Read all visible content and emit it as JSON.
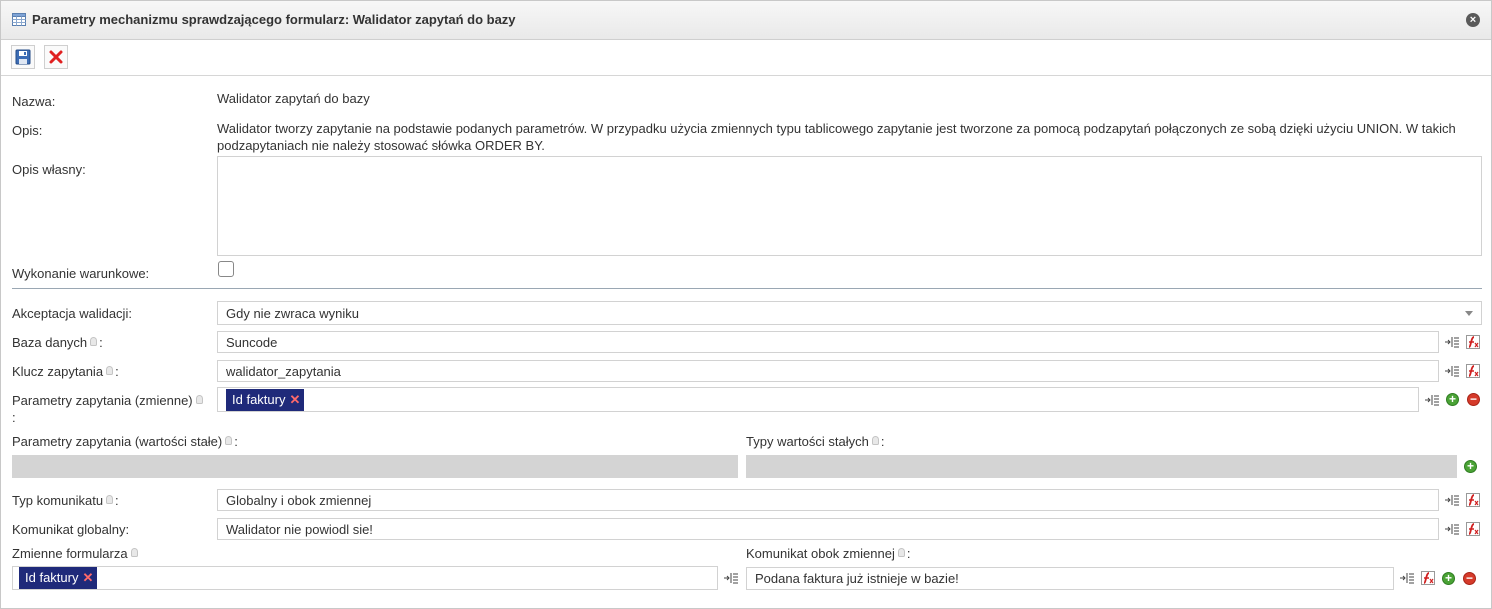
{
  "window": {
    "title": "Parametry mechanizmu sprawdzającego formularz: Walidator zapytań do bazy"
  },
  "form": {
    "nazwa_label": "Nazwa:",
    "nazwa_value": "Walidator zapytań do bazy",
    "opis_label": "Opis:",
    "opis_value_line1": "Walidator tworzy zapytanie na podstawie podanych parametrów. W przypadku użycia zmiennych typu tablicowego zapytanie jest tworzone za pomocą podzapytań połączonych ze sobą dzięki użyciu UNION. W takich",
    "opis_value_line2": "podzapytaniach nie należy stosować słówka ORDER BY.",
    "opis_wlasny_label": "Opis własny:",
    "opis_wlasny_value": "",
    "wykonanie_label": "Wykonanie warunkowe:",
    "wykonanie_checked": false,
    "akceptacja_label": "Akceptacja walidacji:",
    "akceptacja_value": "Gdy nie zwraca wyniku",
    "baza_label": "Baza danych",
    "baza_value": "Suncode",
    "klucz_label": "Klucz zapytania",
    "klucz_value": "walidator_zapytania",
    "param_zmienne_label": "Parametry zapytania (zmienne)",
    "param_zmienne_tags": [
      "Id faktury"
    ],
    "param_stale_label": "Parametry zapytania (wartości stałe)",
    "typy_stalych_label": "Typy wartości stałych",
    "typ_komunikatu_label": "Typ komunikatu",
    "typ_komunikatu_value": "Globalny i obok zmiennej",
    "komunikat_globalny_label": "Komunikat globalny:",
    "komunikat_globalny_value": "Walidator nie powiodl sie!",
    "zmienne_formularza_label": "Zmienne formularza",
    "zmienne_formularza_tags": [
      "Id faktury"
    ],
    "komunikat_obok_label": "Komunikat obok zmiennej",
    "komunikat_obok_value": "Podana faktura już istnieje w bazie!",
    "colon": ":",
    "tag_remove": "✕"
  }
}
